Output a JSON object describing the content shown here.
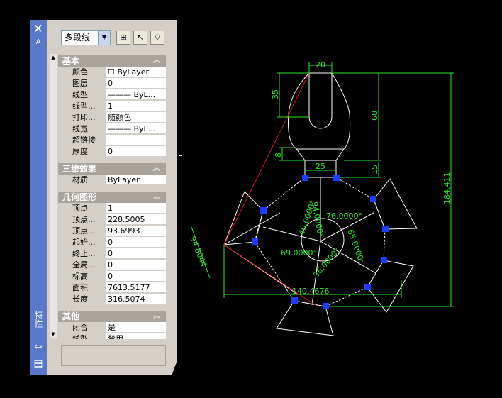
{
  "palette": {
    "title": "特性",
    "object_type": "多段线",
    "auto_label": "A",
    "sections": {
      "general": {
        "title": "基本",
        "rows": [
          {
            "name": "颜色",
            "value": "☐ ByLayer"
          },
          {
            "name": "图层",
            "value": "0"
          },
          {
            "name": "线型",
            "value": "——— ByL..."
          },
          {
            "name": "线型...",
            "value": "1"
          },
          {
            "name": "打印...",
            "value": "随颜色"
          },
          {
            "name": "线宽",
            "value": "——— ByL..."
          },
          {
            "name": "超链接",
            "value": ""
          },
          {
            "name": "厚度",
            "value": "0"
          }
        ]
      },
      "3d": {
        "title": "三维效果",
        "rows": [
          {
            "name": "材质",
            "value": "ByLayer"
          }
        ]
      },
      "geometry": {
        "title": "几何图形",
        "rows": [
          {
            "name": "顶点",
            "value": "1"
          },
          {
            "name": "顶点...",
            "value": "228.5005"
          },
          {
            "name": "顶点...",
            "value": "93.6993"
          },
          {
            "name": "起始...",
            "value": "0"
          },
          {
            "name": "终止...",
            "value": "0"
          },
          {
            "name": "全局...",
            "value": "0"
          },
          {
            "name": "标高",
            "value": "0"
          },
          {
            "name": "面积",
            "value": "7613.5177"
          },
          {
            "name": "长度",
            "value": "316.5074"
          }
        ]
      },
      "misc": {
        "title": "其他",
        "rows": [
          {
            "name": "闭合",
            "value": "是"
          },
          {
            "name": "线型...",
            "value": "禁用"
          }
        ]
      }
    }
  },
  "drawing": {
    "dimensions": {
      "top_width": "20",
      "slot_depth": "35",
      "body_height": "68",
      "neck_height": "8",
      "neck_width": "25",
      "neck_gap": "15",
      "total_height": "184.411",
      "bottom_width": "140.4676",
      "left_dim": "94.8044",
      "angle_1": "76.0000°",
      "angle_2": "65.0000°",
      "angle_3": "69.0000°",
      "angle_4": "36.0000°",
      "angle_5": "40.0000°",
      "angle_6": "94.0000°"
    },
    "colors": {
      "dimension": "#28e628",
      "geometry": "#ffffff",
      "grip": "#1e3cff",
      "highlight": "#e01010"
    }
  }
}
